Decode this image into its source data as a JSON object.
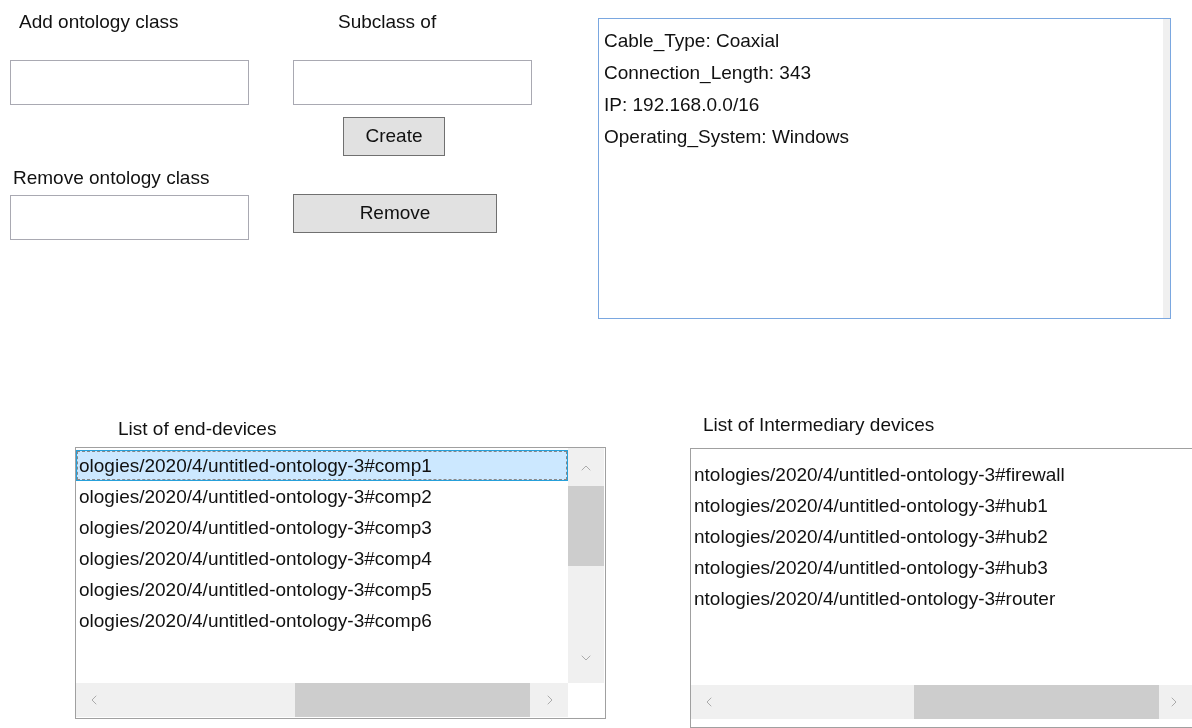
{
  "add_class": {
    "label": "Add ontology class"
  },
  "subclass": {
    "label": "Subclass of"
  },
  "create_button": "Create",
  "remove_class": {
    "label": "Remove ontology class"
  },
  "remove_button": "Remove",
  "properties_box": {
    "lines": [
      "Cable_Type: Coaxial",
      "Connection_Length: 343",
      "IP: 192.168.0.0/16",
      "Operating_System: Windows"
    ]
  },
  "end_devices": {
    "label": "List of end-devices",
    "items": [
      {
        "text": "ologies/2020/4/untitled-ontology-3#comp1",
        "selected": true
      },
      {
        "text": "ologies/2020/4/untitled-ontology-3#comp2",
        "selected": false
      },
      {
        "text": "ologies/2020/4/untitled-ontology-3#comp3",
        "selected": false
      },
      {
        "text": "ologies/2020/4/untitled-ontology-3#comp4",
        "selected": false
      },
      {
        "text": "ologies/2020/4/untitled-ontology-3#comp5",
        "selected": false
      },
      {
        "text": "ologies/2020/4/untitled-ontology-3#comp6",
        "selected": false
      }
    ]
  },
  "intermediary_devices": {
    "label": "List of Intermediary devices",
    "items": [
      {
        "text": "ntologies/2020/4/untitled-ontology-3#firewall",
        "selected": false
      },
      {
        "text": "ntologies/2020/4/untitled-ontology-3#hub1",
        "selected": false
      },
      {
        "text": "ntologies/2020/4/untitled-ontology-3#hub2",
        "selected": false
      },
      {
        "text": "ntologies/2020/4/untitled-ontology-3#hub3",
        "selected": false
      },
      {
        "text": "ntologies/2020/4/untitled-ontology-3#router",
        "selected": false
      }
    ]
  }
}
